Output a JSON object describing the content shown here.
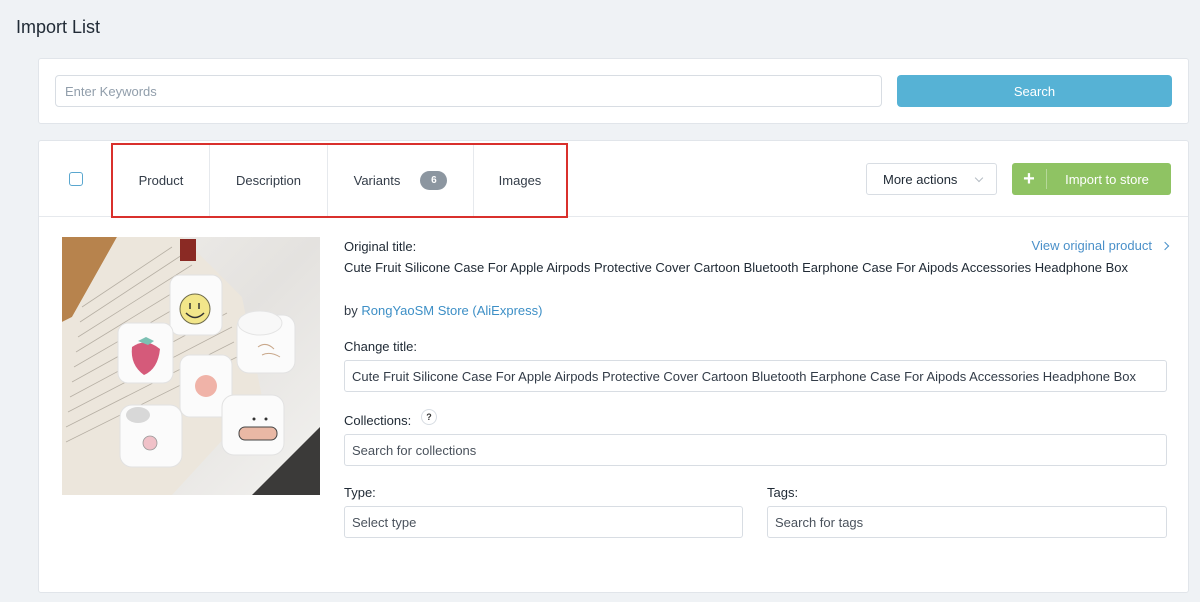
{
  "page": {
    "title": "Import List"
  },
  "search": {
    "placeholder": "Enter Keywords",
    "value": "",
    "button_label": "Search",
    "button_color": "#56b2d5"
  },
  "product_card": {
    "tabs": [
      {
        "label": "Product"
      },
      {
        "label": "Description"
      },
      {
        "label": "Variants",
        "badge": "6"
      },
      {
        "label": "Images"
      }
    ],
    "highlight_color": "#d9302c",
    "more_actions_label": "More actions",
    "import_label": "Import to store",
    "import_color": "#8fc363",
    "original_title_label": "Original title:",
    "original_title": "Cute Fruit Silicone Case For Apple Airpods Protective Cover Cartoon Bluetooth Earphone Case For Aipods Accessories Headphone Box",
    "by_prefix": "by",
    "store_link": "RongYaoSM Store (AliExpress)",
    "view_original_label": "View original product",
    "change_title_label": "Change title:",
    "change_title_value": "Cute Fruit Silicone Case For Apple Airpods Protective Cover Cartoon Bluetooth Earphone Case For Aipods Accessories Headphone Box",
    "collections_label": "Collections:",
    "collections_help": "?",
    "collections_placeholder": "Search for collections",
    "type_label": "Type:",
    "type_placeholder": "Select type",
    "tags_label": "Tags:",
    "tags_placeholder": "Search for tags",
    "image_alt": "White AirPods cases with cute cartoon prints (smiley, strawberry, peach, paw) on marble and an open book"
  }
}
